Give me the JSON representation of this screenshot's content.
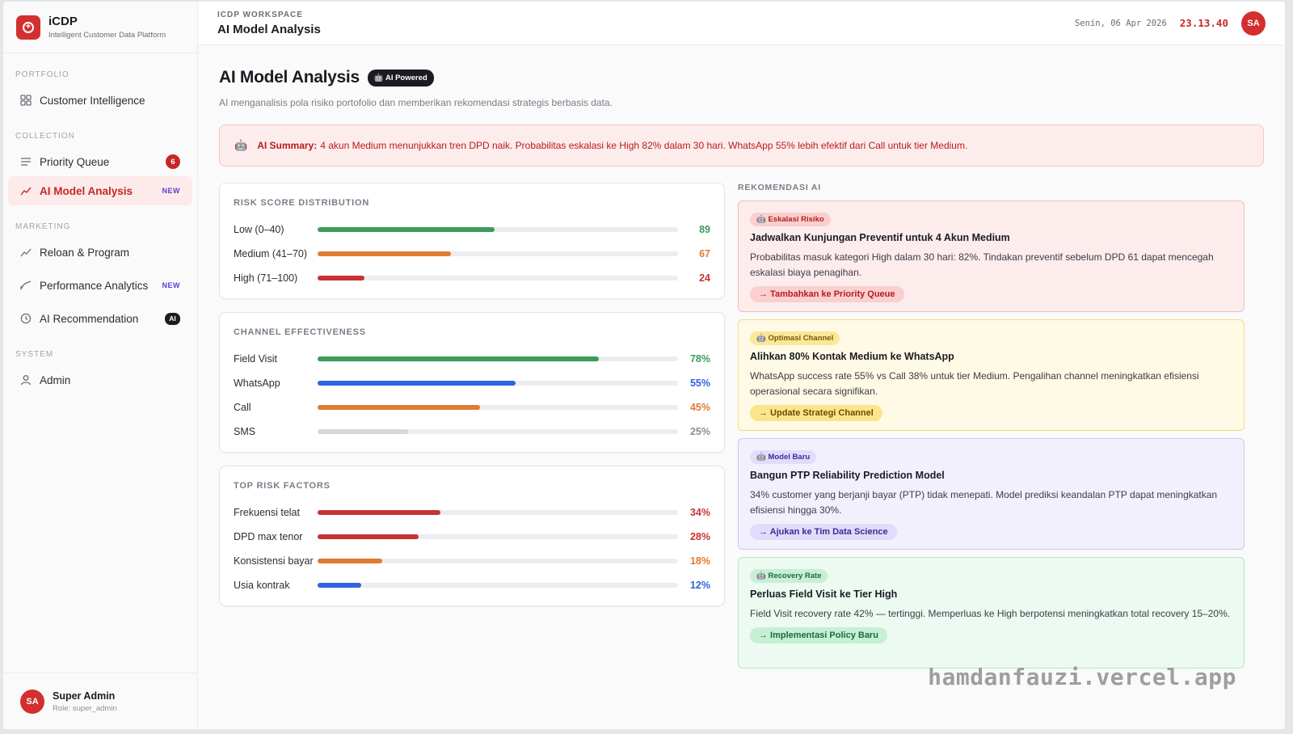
{
  "brand": {
    "name": "iCDP",
    "subtitle": "Intelligent Customer Data Platform"
  },
  "sidebar": {
    "sections": [
      {
        "label": "PORTFOLIO",
        "items": [
          {
            "label": "Customer Intelligence",
            "icon": "grid-icon"
          }
        ]
      },
      {
        "label": "COLLECTION",
        "items": [
          {
            "label": "Priority Queue",
            "icon": "list-icon",
            "badge": "6"
          },
          {
            "label": "AI Model Analysis",
            "icon": "trend-icon",
            "badge": "NEW",
            "active": true
          }
        ]
      },
      {
        "label": "MARKETING",
        "items": [
          {
            "label": "Reloan & Program",
            "icon": "trend-icon"
          },
          {
            "label": "Performance Analytics",
            "icon": "curve-icon",
            "badge": "NEW"
          },
          {
            "label": "AI Recommendation",
            "icon": "clock-icon",
            "badge": "AI"
          }
        ]
      },
      {
        "label": "SYSTEM",
        "items": [
          {
            "label": "Admin",
            "icon": "user-icon"
          }
        ]
      }
    ],
    "user": {
      "initials": "SA",
      "name": "Super Admin",
      "role": "Role: super_admin"
    }
  },
  "topbar": {
    "workspace_label": "ICDP WORKSPACE",
    "title": "AI Model Analysis",
    "date": "Senin, 06 Apr 2026",
    "time": "23.13.40",
    "avatar": "SA"
  },
  "page": {
    "title": "AI Model Analysis",
    "pill": "🤖 AI Powered",
    "subtitle": "AI menganalisis pola risiko portofolio dan memberikan rekomendasi strategis berbasis data.",
    "summary_label": "AI Summary:",
    "summary_text": "4 akun Medium menunjukkan tren DPD naik. Probabilitas eskalasi ke High 82% dalam 30 hari. WhatsApp 55% lebih efektif dari Call untuk tier Medium."
  },
  "cards": [
    {
      "title": "RISK SCORE DISTRIBUTION",
      "rows": [
        {
          "label": "Low (0–40)",
          "value": "89",
          "fraction": 0.49,
          "color": "#3f9a5c"
        },
        {
          "label": "Medium (41–70)",
          "value": "67",
          "fraction": 0.37,
          "color": "#e07b32"
        },
        {
          "label": "High (71–100)",
          "value": "24",
          "fraction": 0.13,
          "color": "#c73232"
        }
      ]
    },
    {
      "title": "CHANNEL EFFECTIVENESS",
      "rows": [
        {
          "label": "Field Visit",
          "value": "78%",
          "fraction": 0.78,
          "color": "#3f9a5c"
        },
        {
          "label": "WhatsApp",
          "value": "55%",
          "fraction": 0.55,
          "color": "#2f62e0"
        },
        {
          "label": "Call",
          "value": "45%",
          "fraction": 0.45,
          "color": "#e07b32"
        },
        {
          "label": "SMS",
          "value": "25%",
          "fraction": 0.25,
          "color": "#d6d7dc"
        }
      ]
    },
    {
      "title": "TOP RISK FACTORS",
      "rows": [
        {
          "label": "Frekuensi telat",
          "value": "34%",
          "fraction": 0.34,
          "color": "#c73232"
        },
        {
          "label": "DPD max tenor",
          "value": "28%",
          "fraction": 0.28,
          "color": "#c73232"
        },
        {
          "label": "Konsistensi bayar",
          "value": "18%",
          "fraction": 0.18,
          "color": "#e07b32"
        },
        {
          "label": "Usia kontrak",
          "value": "12%",
          "fraction": 0.12,
          "color": "#2f62e0"
        }
      ]
    }
  ],
  "recommendations": {
    "title": "REKOMENDASI AI",
    "items": [
      {
        "tag": "🤖 Eskalasi Risiko",
        "title": "Jadwalkan Kunjungan Preventif untuk 4 Akun Medium",
        "desc": "Probabilitas masuk kategori High dalam 30 hari: 82%. Tindakan preventif sebelum DPD 61 dapat mencegah eskalasi biaya penagihan.",
        "action": "→ Tambahkan ke Priority Queue",
        "bg": "#fdecec",
        "border": "#f0bcbc",
        "tag_bg": "#f9cfcf",
        "tag_color": "#b71c1c",
        "act_bg": "#f9cfcf",
        "act_color": "#b71c1c"
      },
      {
        "tag": "🤖 Optimasi Channel",
        "title": "Alihkan 80% Kontak Medium ke WhatsApp",
        "desc": "WhatsApp success rate 55% vs Call 38% untuk tier Medium. Pengalihan channel meningkatkan efisiensi operasional secara signifikan.",
        "action": "→ Update Strategi Channel",
        "bg": "#fefae6",
        "border": "#f3de84",
        "tag_bg": "#fbe79a",
        "tag_color": "#7a5a00",
        "act_bg": "#fbe48a",
        "act_color": "#6b4e00"
      },
      {
        "tag": "🤖 Model Baru",
        "title": "Bangun PTP Reliability Prediction Model",
        "desc": "34% customer yang berjanji bayar (PTP) tidak menepati. Model prediksi keandalan PTP dapat meningkatkan efisiensi hingga 30%.",
        "action": "→ Ajukan ke Tim Data Science",
        "bg": "#f3f0fd",
        "border": "#cfc6f3",
        "tag_bg": "#e2dcfa",
        "tag_color": "#3d2a9a",
        "act_bg": "#e2dcfa",
        "act_color": "#3d2a9a"
      },
      {
        "tag": "🤖 Recovery Rate",
        "title": "Perluas Field Visit ke Tier High",
        "desc": "Field Visit recovery rate 42% — tertinggi. Memperluas ke High berpotensi meningkatkan total recovery 15–20%.",
        "action": "→ Implementasi Policy Baru",
        "bg": "#ecfaf2",
        "border": "#b5e6c8",
        "tag_bg": "#c7efd6",
        "tag_color": "#1c6b3b",
        "act_bg": "#c7efd6",
        "act_color": "#1c6b3b"
      }
    ]
  },
  "watermark": "hamdanfauzi.vercel.app"
}
